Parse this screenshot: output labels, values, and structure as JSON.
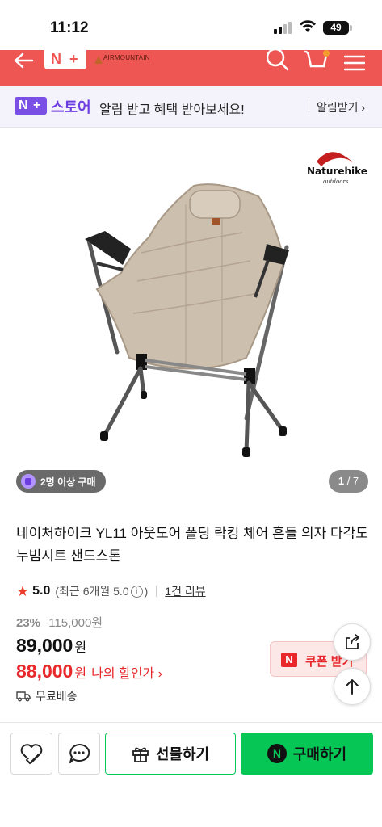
{
  "status_bar": {
    "time": "11:12",
    "battery": "49"
  },
  "header": {
    "nplus_logo": {
      "n": "N",
      "plus": "+"
    },
    "brand_name": "AIRMOUNTAIN"
  },
  "notification": {
    "logo_n": "N",
    "logo_plus": "+",
    "store_label": "스토어",
    "message": "알림 받고 혜택 받아보세요!",
    "subscribe_label": "알림받기 ›"
  },
  "product_image": {
    "brand_logo_text": "Naturehike",
    "brand_logo_sub": "outdoors",
    "buyers_badge": "2명 이상 구매",
    "counter_current": "1",
    "counter_total": " / 7"
  },
  "product": {
    "title": "네이처하이크 YL11 아웃도어 폴딩 락킹 체어 흔들 의자 다각도 누빔시트 샌드스톤",
    "rating": "5.0",
    "rating_recent": "(최근 6개월 5.0",
    "rating_info": "i",
    "rating_close": ")",
    "reviews": "1건 리뷰",
    "discount_pct": "23%",
    "original_price": "115,000원",
    "price": "89,000",
    "price_unit": "원",
    "my_price": "88,000",
    "my_price_unit": "원",
    "my_price_label": "나의 할인가 ›",
    "shipping": "무료배송"
  },
  "coupon": {
    "badge": "N",
    "label": "쿠폰 받기"
  },
  "bottom_bar": {
    "gift_label": "선물하기",
    "buy_badge": "N",
    "buy_label": "구매하기"
  },
  "colors": {
    "header_red": "#ed5652",
    "naver_green": "#06c755",
    "store_purple": "#6d3fe0",
    "price_red": "#e8282b"
  }
}
